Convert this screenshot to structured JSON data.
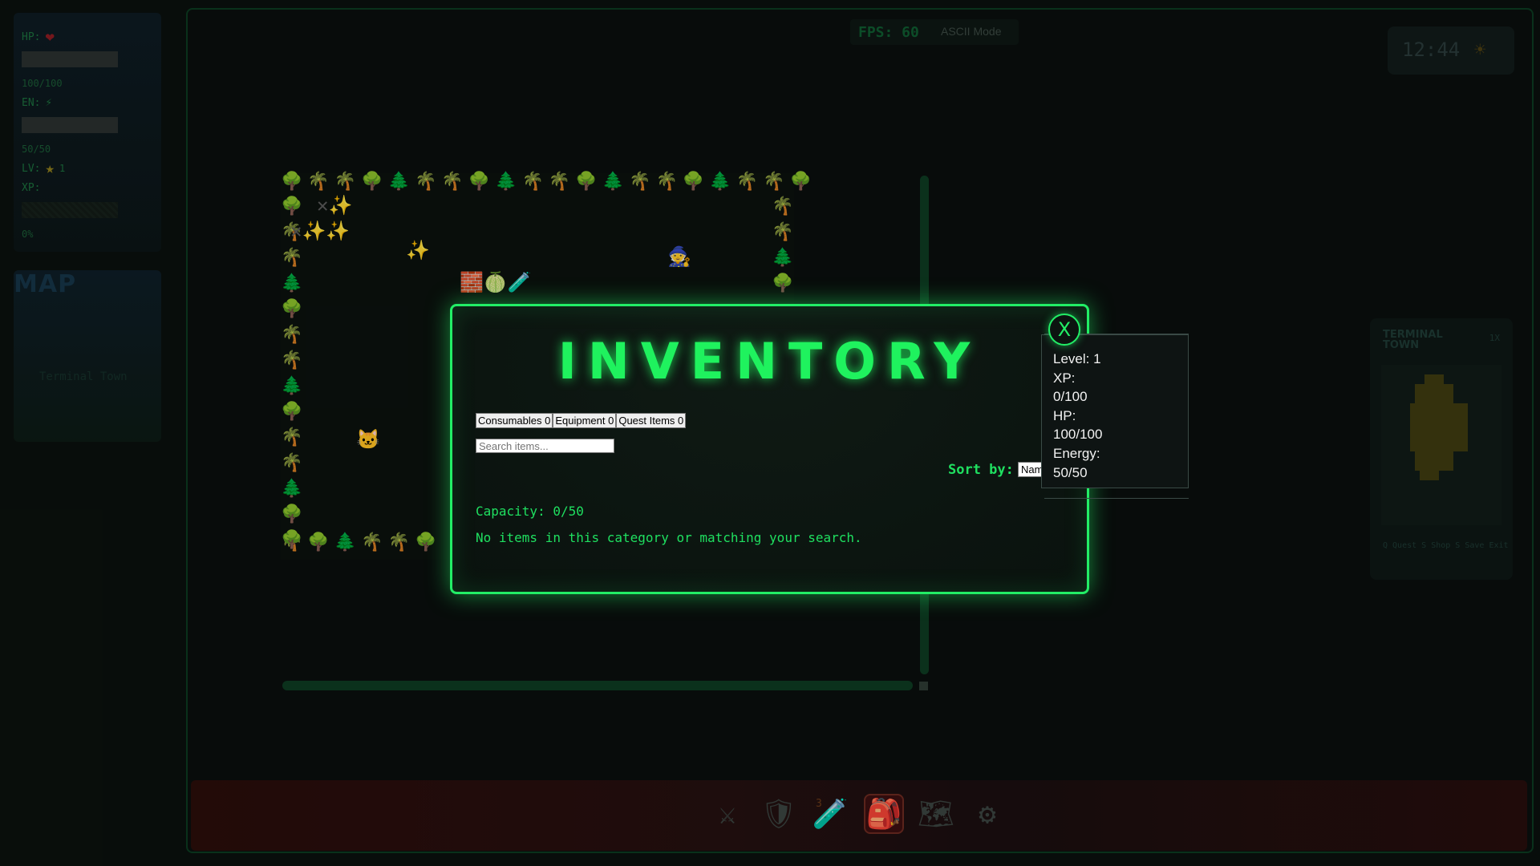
{
  "hud": {
    "hp_label": "HP:",
    "hp_value": "100/100",
    "en_label": "EN:",
    "en_value": "50/50",
    "lv_label": "LV:",
    "lv_value": "1",
    "xp_label": "XP:",
    "xp_value": "0%"
  },
  "map_panel": {
    "title": "MAP",
    "location": "Terminal Town"
  },
  "top_bar": {
    "fps": "FPS: 60",
    "mode": "ASCII Mode",
    "clock": "12:44"
  },
  "right_minimap": {
    "title": "TERMINAL TOWN",
    "scale": "1X",
    "actions": "Q Quest  S Shop  S Save  Exit"
  },
  "hotbar": {
    "items": [
      "swords-icon",
      "shield-icon",
      "potion-icon",
      "backpack-icon",
      "map-icon",
      "gear-icon"
    ],
    "potion_count": "3",
    "active_index": 3
  },
  "inventory": {
    "title": "INVENTORY",
    "close_label": "X",
    "tabs": [
      {
        "label": "Consumables 0"
      },
      {
        "label": "Equipment 0"
      },
      {
        "label": "Quest Items 0"
      }
    ],
    "search_placeholder": "Search items...",
    "sort_label": "Sort by:",
    "sort_value": "Name",
    "capacity": "Capacity: 0/50",
    "empty_message": "No items in this category or matching your search."
  },
  "tooltip": {
    "lines": [
      "Level: 1",
      "XP:",
      "0/100",
      "HP:",
      "100/100",
      "Energy:",
      "50/50"
    ]
  },
  "colors": {
    "accent": "#22ee66",
    "background": "#0a100d"
  }
}
